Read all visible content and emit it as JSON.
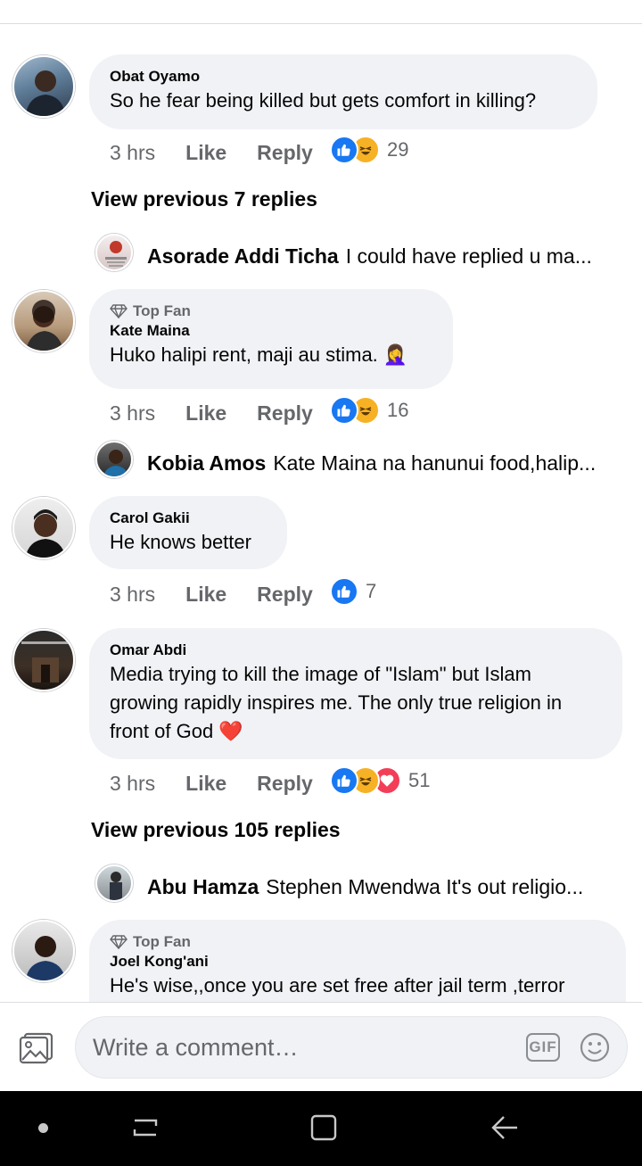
{
  "comments": [
    {
      "name": "Obat Oyamo",
      "text": "So he fear being killed but gets comfort in killing?",
      "time": "3 hrs",
      "like_label": "Like",
      "reply_label": "Reply",
      "reactions": [
        "like",
        "haha"
      ],
      "reaction_count": "29",
      "view_previous": "View previous 7 replies",
      "reply_preview": {
        "name": "Asorade Addi Ticha",
        "text": "I could have replied u ma..."
      }
    },
    {
      "badge": "Top Fan",
      "name": "Kate Maina",
      "text": "Huko halipi rent, maji au stima. 🤦‍♀️",
      "time": "3 hrs",
      "like_label": "Like",
      "reply_label": "Reply",
      "reactions": [
        "like",
        "haha"
      ],
      "reaction_count": "16",
      "reply_preview": {
        "name": "Kobia Amos",
        "text": "Kate Maina na hanunui food,halip..."
      }
    },
    {
      "name": "Carol Gakii",
      "text": "He knows better",
      "time": "3 hrs",
      "like_label": "Like",
      "reply_label": "Reply",
      "reactions": [
        "like"
      ],
      "reaction_count": "7"
    },
    {
      "name": "Omar Abdi",
      "text": "Media trying to kill the image of \"Islam\" but Islam growing rapidly inspires me. The only true religion in front of God ❤️",
      "time": "3 hrs",
      "like_label": "Like",
      "reply_label": "Reply",
      "reactions": [
        "like",
        "haha",
        "love"
      ],
      "reaction_count": "51",
      "view_previous": "View previous 105 replies",
      "reply_preview": {
        "name": "Abu Hamza",
        "text": "Stephen Mwendwa It's out religio..."
      }
    },
    {
      "badge": "Top Fan",
      "name": "Joel Kong'ani",
      "text": "He's wise,,once you are set free after jail term ,terror"
    }
  ],
  "composer": {
    "placeholder": "Write a comment…",
    "gif_label": "GIF"
  },
  "colors": {
    "bubble": "#f0f2f5",
    "secondary_text": "#65676b",
    "like_blue": "#1877f2",
    "haha_yellow": "#f7b125",
    "love_red": "#f33e58"
  }
}
